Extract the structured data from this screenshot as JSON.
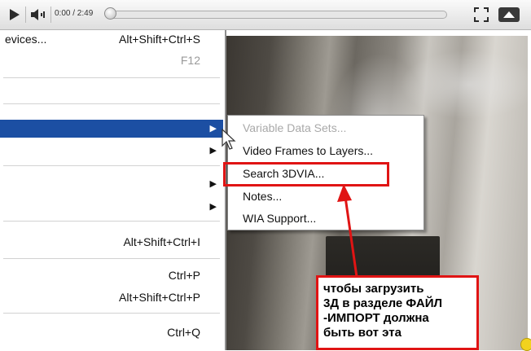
{
  "player": {
    "time": "0:00 / 2:49",
    "progress_fraction": 0.0,
    "icons": {
      "play": "play-icon",
      "volume": "volume-icon",
      "fullscreen": "fullscreen-icon",
      "popout": "expand-up-icon"
    }
  },
  "file_menu": {
    "items": [
      {
        "label": "evices...",
        "shortcut": "Alt+Shift+Ctrl+S"
      },
      {
        "label": "",
        "shortcut": "F12"
      },
      {
        "label": "",
        "shortcut": "",
        "submenu": true,
        "highlighted": true
      },
      {
        "label": "",
        "shortcut": "",
        "submenu": true
      },
      {
        "label": "",
        "shortcut": "",
        "submenu": true
      },
      {
        "label": "",
        "shortcut": "",
        "submenu": true
      },
      {
        "label": "",
        "shortcut": "Alt+Shift+Ctrl+I"
      },
      {
        "label": "",
        "shortcut": "Ctrl+P"
      },
      {
        "label": "",
        "shortcut": "Alt+Shift+Ctrl+P"
      },
      {
        "label": "",
        "shortcut": "Ctrl+Q"
      }
    ]
  },
  "submenu": {
    "items": [
      {
        "label": "Variable Data Sets...",
        "disabled": true
      },
      {
        "label": "Video Frames to Layers...",
        "disabled": false
      },
      {
        "label": "Search 3DVIA...",
        "disabled": false,
        "circled": true
      },
      {
        "label": "Notes...",
        "disabled": false
      },
      {
        "label": "WIA Support...",
        "disabled": false
      }
    ]
  },
  "annotation": {
    "lines": [
      "чтобы загрузить",
      "3Д в разделе ФАЙЛ",
      "-ИМПОРТ должна",
      "быть вот эта"
    ],
    "color": "#e01414"
  },
  "colors": {
    "menu_highlight": "#1c4fa3",
    "annotation_red": "#e01414"
  }
}
